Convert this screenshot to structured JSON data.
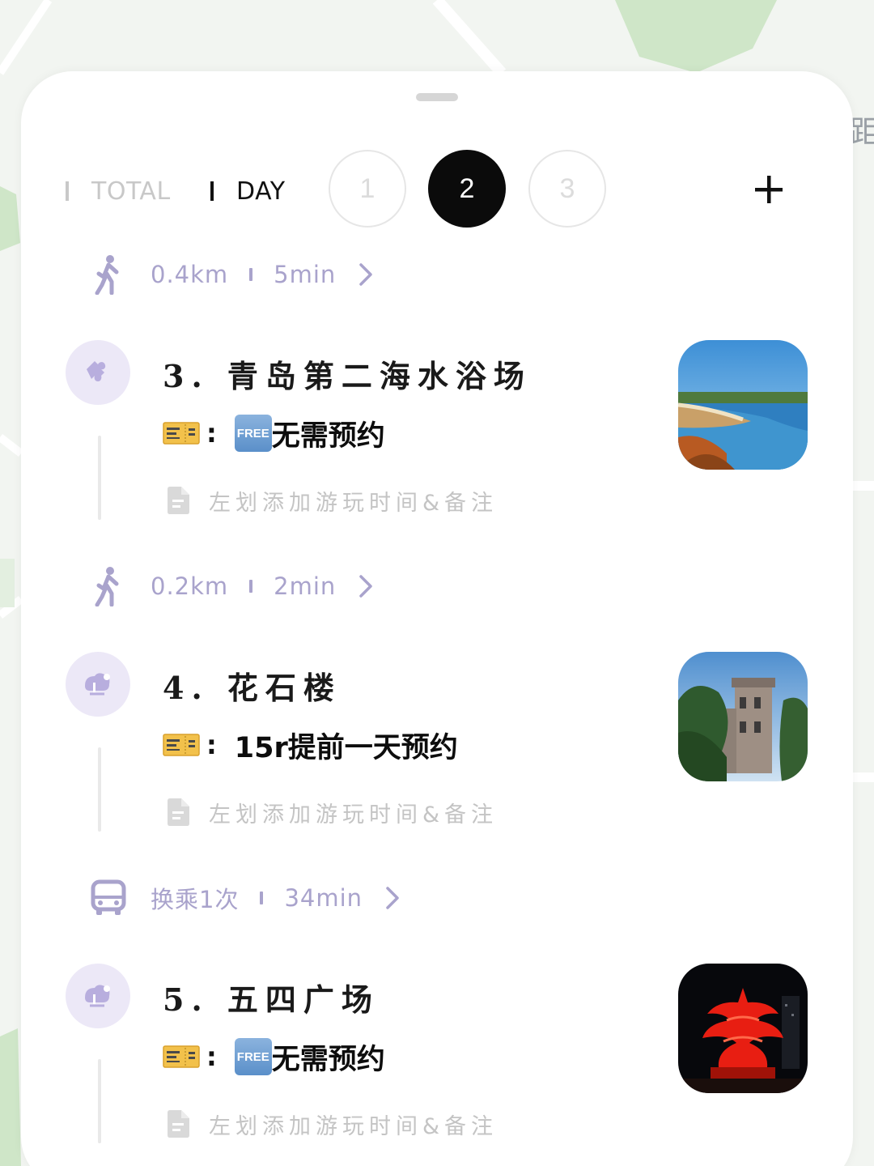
{
  "map": {
    "edge_glyph": "距"
  },
  "tabs": {
    "total_label": "TOTAL",
    "day_label": "DAY"
  },
  "days": [
    {
      "label": "1",
      "selected": false
    },
    {
      "label": "2",
      "selected": true
    },
    {
      "label": "3",
      "selected": false
    }
  ],
  "add_icon": "plus-icon",
  "transits": [
    {
      "mode": "walk-icon",
      "distance": "0.4km",
      "duration": "5min"
    },
    {
      "mode": "walk-icon",
      "distance": "0.2km",
      "duration": "2min"
    },
    {
      "mode": "bus-icon",
      "distance": "换乘1次",
      "duration": "34min"
    }
  ],
  "stops": [
    {
      "title": "3. 青岛第二海水浴场",
      "category_icon": "puzzle-icon",
      "ticket_icon": "ticket-icon",
      "free_badge": "FREE",
      "ticket_text": "无需预约",
      "note_placeholder": "左划添加游玩时间&备注",
      "photo": "beach-photo"
    },
    {
      "title": "4. 花石楼",
      "category_icon": "scenery-icon",
      "ticket_icon": "ticket-icon",
      "free_badge": "",
      "ticket_text": "15r提前一天预约",
      "note_placeholder": "左划添加游玩时间&备注",
      "photo": "castle-photo"
    },
    {
      "title": "5. 五四广场",
      "category_icon": "scenery-icon",
      "ticket_icon": "ticket-icon",
      "free_badge": "FREE",
      "ticket_text": "无需预约",
      "note_placeholder": "左划添加游玩时间&备注",
      "photo": "may-fourth-sculpture-photo"
    }
  ],
  "colors": {
    "accent_purple": "#a9a3cc",
    "icon_circle_bg": "#ece8f7",
    "selected_day_bg": "#0b0b0b"
  }
}
